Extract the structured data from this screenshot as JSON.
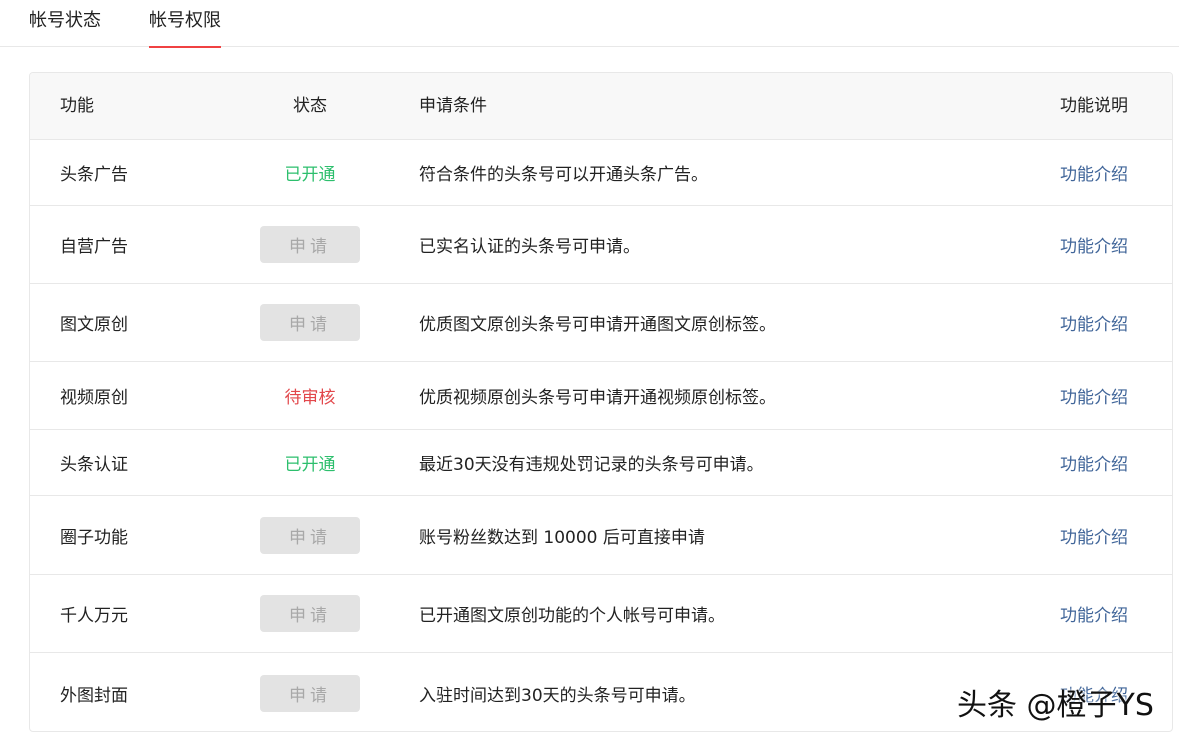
{
  "tabs": [
    {
      "label": "帐号状态",
      "active": false
    },
    {
      "label": "帐号权限",
      "active": true
    }
  ],
  "table": {
    "headers": {
      "name": "功能",
      "status": "状态",
      "condition": "申请条件",
      "description": "功能说明"
    },
    "rows": [
      {
        "name": "头条广告",
        "status_type": "opened",
        "status": "已开通",
        "condition": "符合条件的头条号可以开通头条广告。",
        "link": "功能介绍"
      },
      {
        "name": "自营广告",
        "status_type": "apply",
        "status": "申请",
        "condition": "已实名认证的头条号可申请。",
        "link": "功能介绍"
      },
      {
        "name": "图文原创",
        "status_type": "apply",
        "status": "申请",
        "condition": "优质图文原创头条号可申请开通图文原创标签。",
        "link": "功能介绍"
      },
      {
        "name": "视频原创",
        "status_type": "pending",
        "status": "待审核",
        "condition": "优质视频原创头条号可申请开通视频原创标签。",
        "link": "功能介绍"
      },
      {
        "name": "头条认证",
        "status_type": "opened",
        "status": "已开通",
        "condition": "最近30天没有违规处罚记录的头条号可申请。",
        "link": "功能介绍"
      },
      {
        "name": "圈子功能",
        "status_type": "apply",
        "status": "申请",
        "condition": "账号粉丝数达到 10000 后可直接申请",
        "link": "功能介绍"
      },
      {
        "name": "千人万元",
        "status_type": "apply",
        "status": "申请",
        "condition": "已开通图文原创功能的个人帐号可申请。",
        "link": "功能介绍"
      },
      {
        "name": "外图封面",
        "status_type": "apply",
        "status": "申请",
        "condition": "入驻时间达到30天的头条号可申请。",
        "link": "功能介绍"
      }
    ]
  },
  "watermark": "头条 @橙子YS",
  "colors": {
    "tab_underline": "#f04142",
    "status_opened": "#2dbf6d",
    "status_pending": "#e2474b",
    "link": "#406599",
    "apply_button_bg": "#e3e3e3",
    "apply_button_text": "#a8a8a8"
  }
}
